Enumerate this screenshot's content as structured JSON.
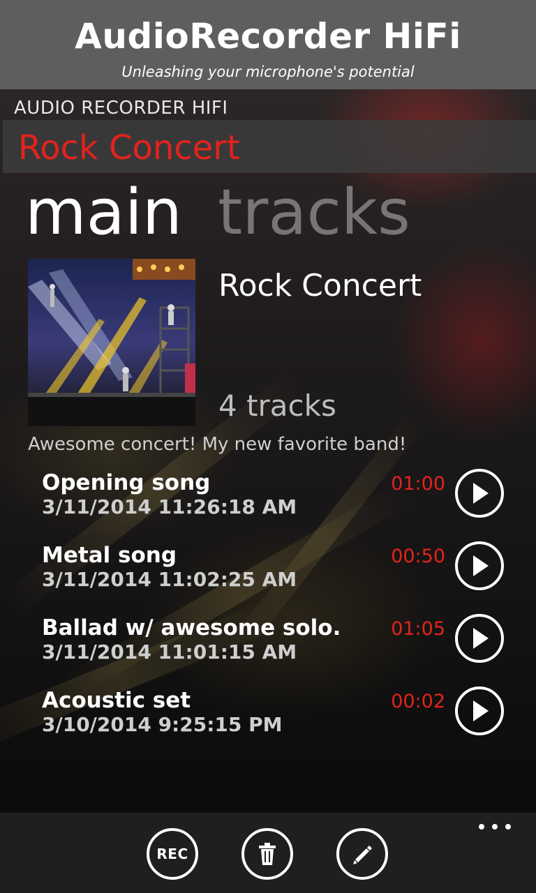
{
  "banner": {
    "title": "AudioRecorder HiFi",
    "tagline": "Unleashing your microphone's potential"
  },
  "app": {
    "title": "AUDIO RECORDER HIFI"
  },
  "album_bar": {
    "title": "Rock Concert"
  },
  "pivot": {
    "items": [
      "main",
      "tracks"
    ],
    "selected": "main"
  },
  "album": {
    "name": "Rock Concert",
    "track_count": "4 tracks",
    "description": "Awesome concert! My new favorite band!"
  },
  "tracks": [
    {
      "name": "Opening song",
      "date": "3/11/2014 11:26:18 AM",
      "duration": "01:00"
    },
    {
      "name": "Metal song",
      "date": "3/11/2014 11:02:25 AM",
      "duration": "00:50"
    },
    {
      "name": "Ballad w/ awesome solo.",
      "date": "3/11/2014 11:01:15 AM",
      "duration": "01:05"
    },
    {
      "name": "Acoustic set",
      "date": "3/10/2014 9:25:15 PM",
      "duration": "00:02"
    }
  ],
  "appbar": {
    "rec_label": "REC",
    "buttons": [
      "record-icon",
      "trash-icon",
      "pencil-icon"
    ],
    "more": "more-icon"
  },
  "colors": {
    "accent": "#e3231c",
    "banner_bg": "#5e5e5e",
    "appbar_bg": "#1f1f1f"
  }
}
